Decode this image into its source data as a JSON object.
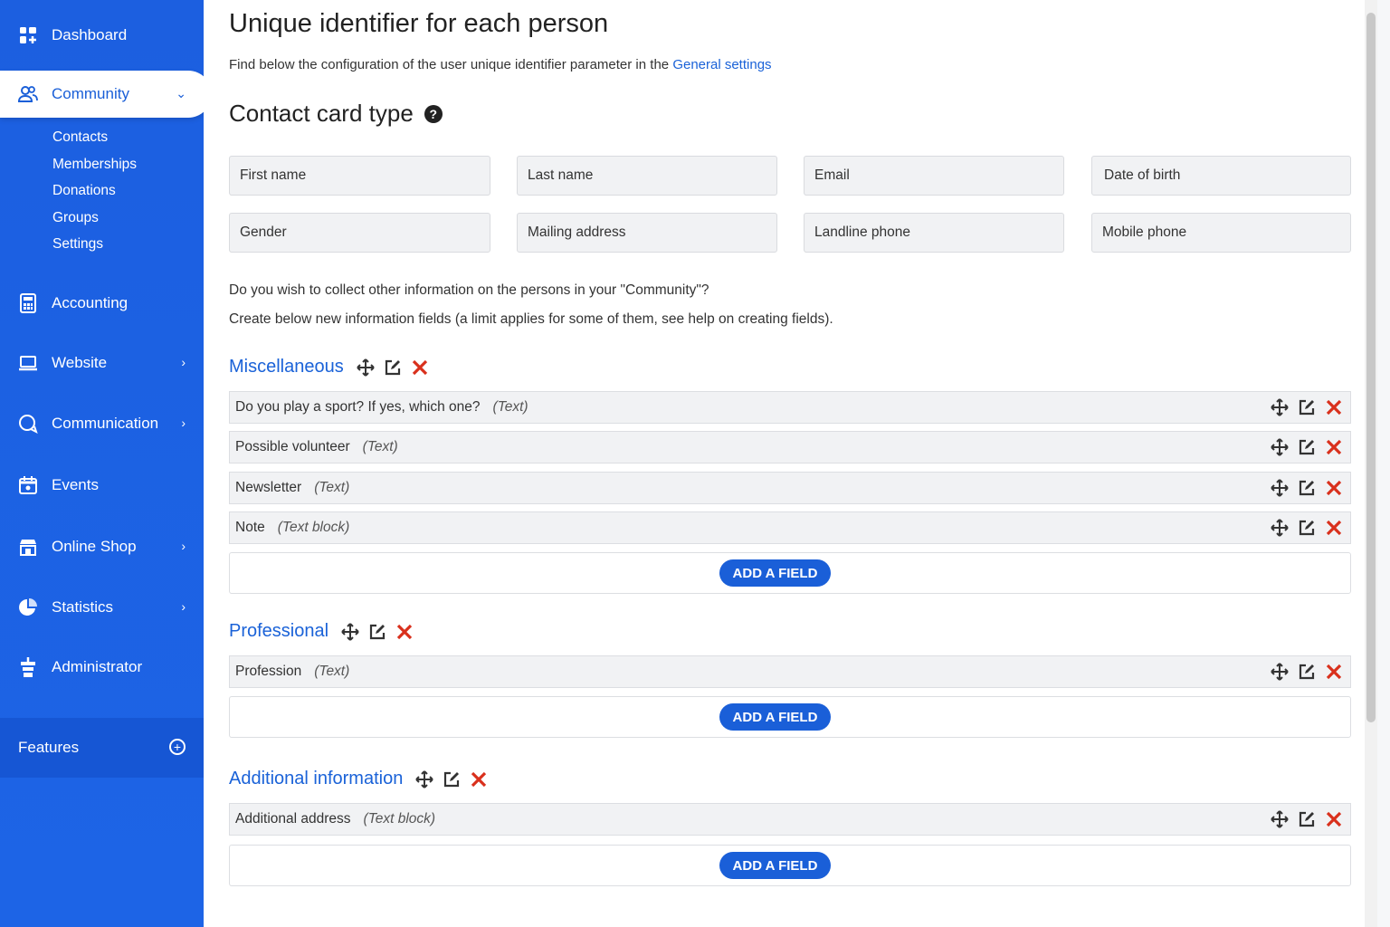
{
  "sidebar": {
    "items": [
      {
        "label": "Dashboard",
        "icon": "dashboard-icon"
      },
      {
        "label": "Community",
        "icon": "community-icon"
      },
      {
        "label": "Accounting",
        "icon": "calculator-icon"
      },
      {
        "label": "Website",
        "icon": "laptop-icon"
      },
      {
        "label": "Communication",
        "icon": "chat-icon"
      },
      {
        "label": "Events",
        "icon": "calendar-icon"
      },
      {
        "label": "Online Shop",
        "icon": "store-icon"
      },
      {
        "label": "Statistics",
        "icon": "pie-chart-icon"
      },
      {
        "label": "Administrator",
        "icon": "admin-icon"
      }
    ],
    "community_sub": [
      "Contacts",
      "Memberships",
      "Donations",
      "Groups",
      "Settings"
    ],
    "features_label": "Features"
  },
  "main": {
    "title": "Unique identifier for each person",
    "desc_text": "Find below the configuration of the user unique identifier parameter in the ",
    "desc_link": "General settings",
    "contact_title": "Contact card type",
    "contact_fields": [
      "First name",
      "Last name",
      "Email",
      "Date of birth",
      "Gender",
      "Mailing address",
      "Landline phone",
      "Mobile phone"
    ],
    "question": "Do you wish to collect other information on the persons in your \"Community\"?",
    "instruction": "Create below new information fields (a limit applies for some of them, see help on creating fields).",
    "add_field_label": "ADD A FIELD",
    "sections": [
      {
        "title": "Miscellaneous",
        "fields": [
          {
            "label": "Do you play a sport? If yes, which one?",
            "type": "(Text)"
          },
          {
            "label": "Possible volunteer",
            "type": "(Text)"
          },
          {
            "label": "Newsletter",
            "type": "(Text)"
          },
          {
            "label": "Note",
            "type": "(Text block)"
          }
        ]
      },
      {
        "title": "Professional",
        "fields": [
          {
            "label": "Profession",
            "type": "(Text)"
          }
        ]
      },
      {
        "title": "Additional information",
        "fields": [
          {
            "label": "Additional address",
            "type": "(Text block)"
          }
        ]
      }
    ]
  },
  "colors": {
    "accent": "#1a5fd8",
    "sidebar": "#1c5fe0",
    "delete": "#d9301c"
  }
}
